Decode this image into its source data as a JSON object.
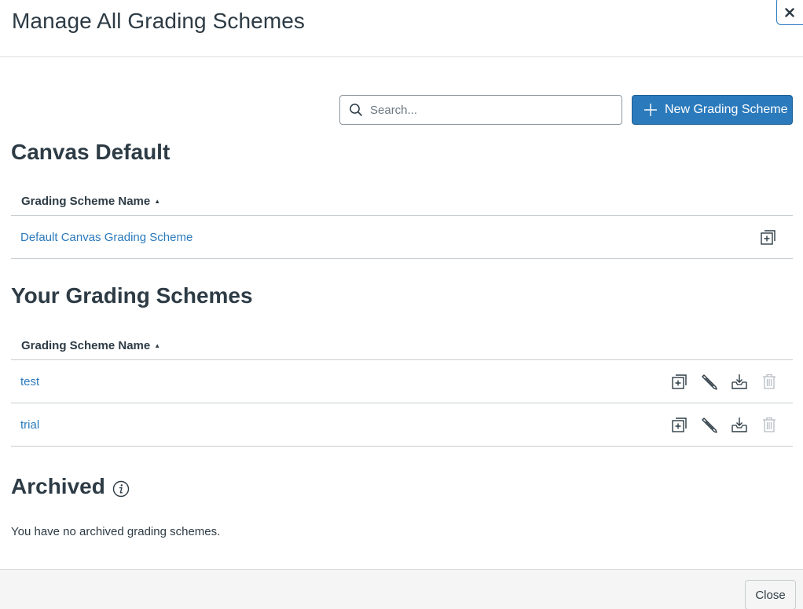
{
  "modal": {
    "title": "Manage All Grading Schemes",
    "close_label": "Close"
  },
  "search": {
    "placeholder": "Search..."
  },
  "new_scheme_button": "New Grading Scheme",
  "canvas_default": {
    "heading": "Canvas Default",
    "column_header": "Grading Scheme Name",
    "rows": [
      {
        "name": "Default Canvas Grading Scheme",
        "actions": [
          "duplicate-icon"
        ]
      }
    ]
  },
  "your_schemes": {
    "heading": "Your Grading Schemes",
    "column_header": "Grading Scheme Name",
    "rows": [
      {
        "name": "test",
        "actions": [
          "duplicate-icon",
          "pencil-icon",
          "archive-icon",
          "trash-icon"
        ]
      },
      {
        "name": "trial",
        "actions": [
          "duplicate-icon",
          "pencil-icon",
          "archive-icon",
          "trash-icon"
        ]
      }
    ]
  },
  "archived": {
    "heading": "Archived",
    "empty_message": "You have no archived grading schemes."
  },
  "colors": {
    "brand": "#2b7abc",
    "text": "#2d3b45",
    "border": "#c7cdd1",
    "disabled_icon": "#b4bcc2"
  }
}
